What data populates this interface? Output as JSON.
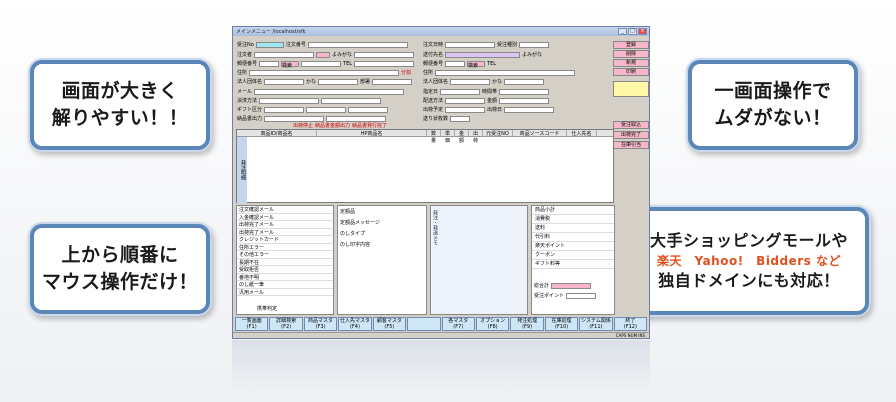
{
  "callouts": {
    "c1_line1": "画面が大きく",
    "c1_line2": "解りやすい！！",
    "c2_line1": "上から順番に",
    "c2_line2": "マウス操作だけ！",
    "c3_line1": "一画面操作で",
    "c3_line2": "ムダがない！",
    "c4_line1": "大手ショッピングモールや",
    "c4_brands": "楽天　Yahoo!　Bidders など",
    "c4_line2": "独自ドメインにも対応！"
  },
  "window": {
    "title": "メインメニュー /localhost/sfk",
    "fields": {
      "order_no": "受注No",
      "customer_no": "注文番号",
      "order_date": "注文日時",
      "order_type": "受注種別",
      "orderer": "注文者",
      "zip": "郵便番号",
      "address": "住所",
      "company": "法人団体名",
      "mail": "メール",
      "payment": "決済方法",
      "gift": "ギフト区分",
      "invoice": "納品書出力",
      "dest": "送付先名",
      "dest_zip": "郵便番号",
      "dest_address": "住所",
      "dest_company": "法人団体名",
      "designated": "指定日",
      "delivery": "配送方法",
      "ship_plan": "出荷予定",
      "slip": "送り状枚数",
      "timezone": "時間帯",
      "amount": "金額",
      "ship_date": "出荷日",
      "furigana": "よみがな",
      "tel": "TEL",
      "search": "検索",
      "kana": "かな",
      "dept": "部署",
      "split": "分割"
    },
    "flags": [
      "出荷停止",
      "納品書金額出力",
      "納品書発行完了"
    ],
    "table_headers": [
      "商品ID/商品名",
      "HP商品名",
      "数量",
      "単価",
      "金額",
      "出荷",
      "元受注NO",
      "商品ソースコード",
      "仕入先名"
    ],
    "table_side_label": "発注明細",
    "mail_labels": [
      "注文確認メール",
      "入金確認メール",
      "出荷完了メール",
      "出荷完了メール",
      "クレジットカード",
      "住所エラー",
      "その他エラー",
      "長期不在",
      "受取拒否",
      "番地不明",
      "のし紙一筆",
      "汎用メール"
    ],
    "mail_section": "携帯判定",
    "memo_labels": [
      "定額品",
      "定額品メッセージ",
      "のしタイプ",
      "のし印字内容"
    ],
    "memo_side": "発注・発送メモ",
    "sum_labels": [
      "商品小計",
      "消費税",
      "送料",
      "代引料",
      "楽天ポイント",
      "クーポン",
      "ギフト料等"
    ],
    "grand_total": "総合計",
    "grand_label": "受注ポイント",
    "right_buttons": [
      "登録",
      "削除",
      "新規",
      "印刷",
      "受注取込",
      "出荷完了",
      "在庫引当"
    ],
    "bottom_buttons": [
      "一覧画面\n(F1)",
      "詳細検索\n(F2)",
      "商品マスタ\n(F3)",
      "仕入先マスタ\n(F4)",
      "顧客マスタ\n(F5)",
      "",
      "各マスタ\n(F7)",
      "オプション\n(F8)",
      "発注処理\n(F9)",
      "在庫処理\n(F10)",
      "システム関係\n(F11)",
      "終了\n(F12)"
    ],
    "status": "CAPS NUM INS"
  }
}
